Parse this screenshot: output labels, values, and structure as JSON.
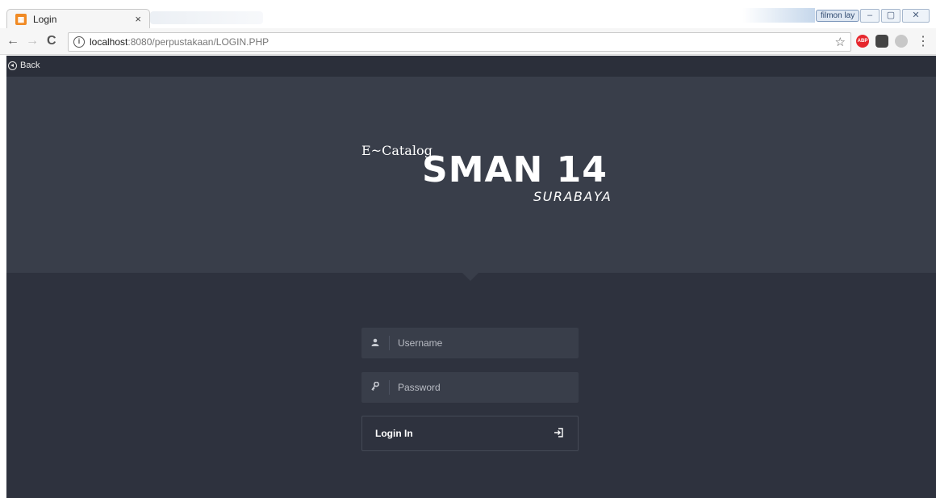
{
  "browser": {
    "tab_title": "Login",
    "tab_favicon": "calendar-favicon-icon",
    "tab_close": "×",
    "user_badge": "filmon lay",
    "url_host": "localhost",
    "url_rest": ":8080/perpustakaan/LOGIN.PHP",
    "window_buttons": {
      "minimize": "–",
      "maximize": "▢",
      "close": "✕"
    }
  },
  "page": {
    "back_label": "Back",
    "logo": {
      "prefix": "E~Catalog",
      "name": "SMAN 14",
      "city": "SURABAYA"
    },
    "form": {
      "username_placeholder": "Username",
      "password_placeholder": "Password",
      "username_value": "",
      "password_value": "",
      "submit_label": "Login In"
    }
  },
  "colors": {
    "page_bg": "#2e323e",
    "hero_bg": "#393e4a",
    "field_bg": "#393e4a"
  }
}
